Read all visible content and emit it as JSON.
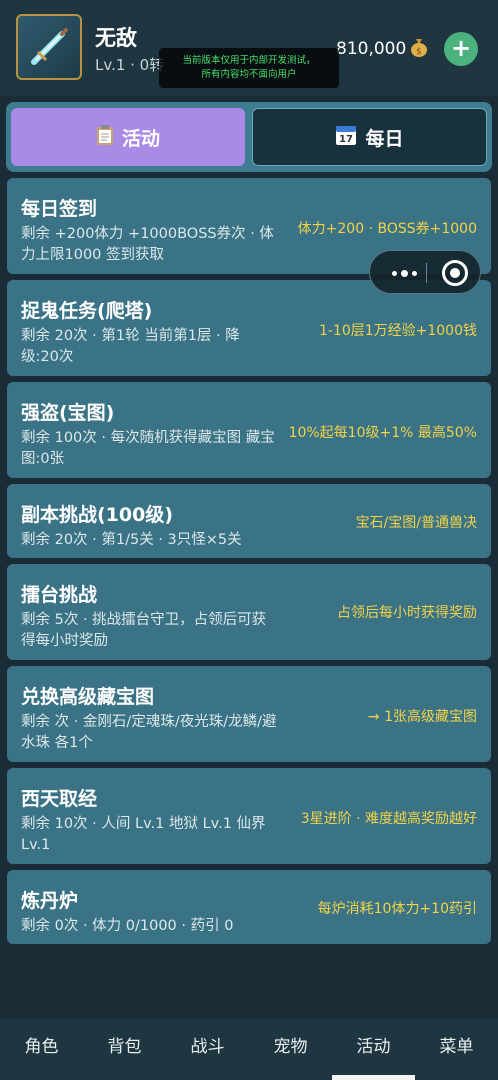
{
  "player": {
    "name": "无敌",
    "level": "Lv.1 · 0转",
    "gold": "810,000",
    "gold_icon": "money-bag-icon",
    "avatar_icon": "sword-icon"
  },
  "notice": {
    "line1": "当前版本仅用于内部开发测试，",
    "line2": "所有内容均不面向用户"
  },
  "tabs": [
    {
      "label": "活动",
      "icon": "clipboard-icon"
    },
    {
      "label": "每日",
      "icon": "calendar-icon"
    }
  ],
  "activities": [
    {
      "title": "每日签到",
      "desc": "剩余 +200体力 +1000BOSS券次 · 体力上限1000 签到获取",
      "reward": "体力+200 · BOSS券+1000"
    },
    {
      "title": "捉鬼任务(爬塔)",
      "desc": "剩余 20次 · 第1轮 当前第1层 · 降级:20次",
      "reward": "1-10层1万经验+1000钱"
    },
    {
      "title": "强盗(宝图)",
      "desc": "剩余 100次 · 每次随机获得藏宝图 藏宝图:0张",
      "reward": "10%起每10级+1% 最高50%"
    },
    {
      "title": "副本挑战(100级)",
      "desc": "剩余 20次 · 第1/5关 · 3只怪×5关",
      "reward": "宝石/宝图/普通兽决"
    },
    {
      "title": "擂台挑战",
      "desc": "剩余 5次 · 挑战擂台守卫，占领后可获得每小时奖励",
      "reward": "占领后每小时获得奖励"
    },
    {
      "title": "兑换高级藏宝图",
      "desc": "剩余 次 · 金刚石/定魂珠/夜光珠/龙鳞/避水珠 各1个",
      "reward": "→ 1张高级藏宝图"
    },
    {
      "title": "西天取经",
      "desc": "剩余 10次 · 人间 Lv.1 地狱 Lv.1 仙界 Lv.1",
      "reward": "3星进阶 · 难度越高奖励越好"
    },
    {
      "title": "炼丹炉",
      "desc": "剩余 0次 · 体力 0/1000 · 药引 0",
      "reward": "每炉消耗10体力+10药引"
    }
  ],
  "nav": [
    "角色",
    "背包",
    "战斗",
    "宠物",
    "活动",
    "菜单"
  ],
  "nav_active": "活动",
  "colors": {
    "background": "#1a2c36",
    "card": "#397385",
    "active_tab": "#a98ae6",
    "reward_text": "#f2d24a",
    "add_button": "#4bb27e"
  }
}
